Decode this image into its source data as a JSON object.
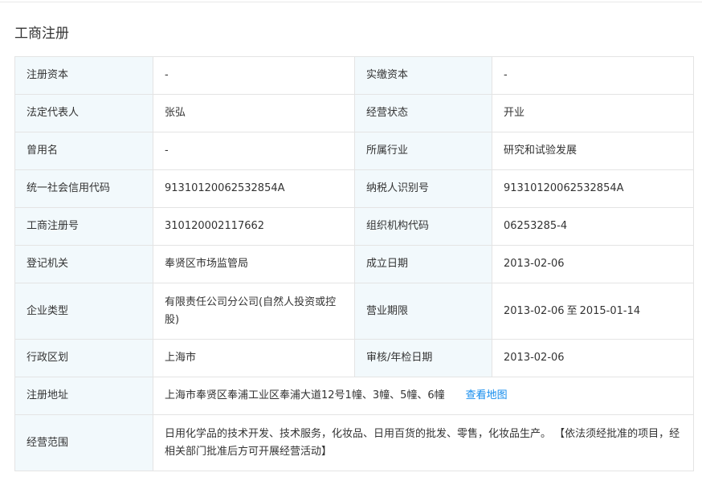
{
  "section": {
    "title": "工商注册"
  },
  "rows": [
    {
      "l1": "注册资本",
      "v1": "-",
      "l2": "实缴资本",
      "v2": "-"
    },
    {
      "l1": "法定代表人",
      "v1": "张弘",
      "l2": "经营状态",
      "v2": "开业"
    },
    {
      "l1": "曾用名",
      "v1": "-",
      "l2": "所属行业",
      "v2": "研究和试验发展"
    },
    {
      "l1": "统一社会信用代码",
      "v1": "91310120062532854A",
      "l2": "纳税人识别号",
      "v2": "91310120062532854A"
    },
    {
      "l1": "工商注册号",
      "v1": "310120002117662",
      "l2": "组织机构代码",
      "v2": "06253285-4"
    },
    {
      "l1": "登记机关",
      "v1": "奉贤区市场监管局",
      "l2": "成立日期",
      "v2": "2013-02-06"
    },
    {
      "l1": "企业类型",
      "v1": "有限责任公司分公司(自然人投资或控股)",
      "l2": "营业期限",
      "v2_start": "2013-02-06",
      "v2_sep": "至",
      "v2_end": "2015-01-14"
    },
    {
      "l1": "行政区划",
      "v1": "上海市",
      "l2": "审核/年检日期",
      "v2": "2013-02-06"
    }
  ],
  "address": {
    "label": "注册地址",
    "value": "上海市奉贤区奉浦工业区奉浦大道12号1幢、3幢、5幢、6幢",
    "link": "查看地图"
  },
  "scope": {
    "label": "经营范围",
    "value": "日用化学品的技术开发、技术服务，化妆品、日用百货的批发、零售，化妆品生产。 【依法须经批准的项目，经相关部门批准后方可开展经营活动】"
  }
}
